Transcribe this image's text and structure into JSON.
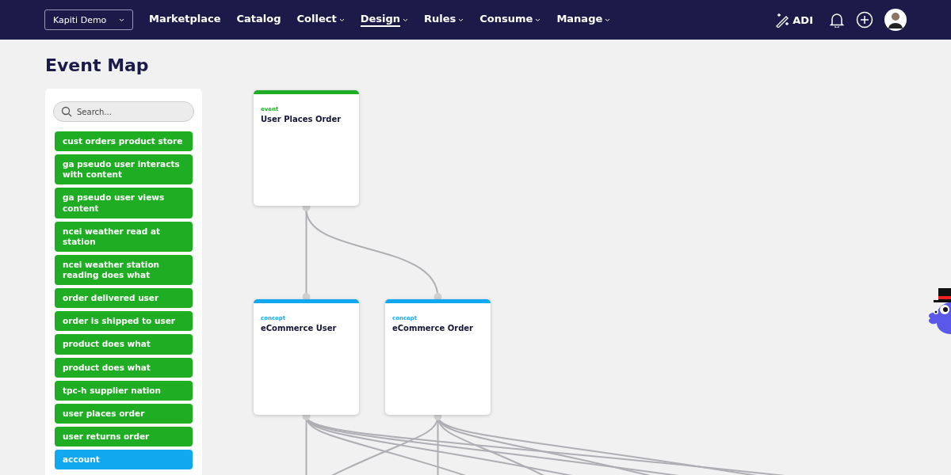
{
  "navbar": {
    "workspace": "Kapiti Demo",
    "items": [
      {
        "label": "Marketplace",
        "has_menu": false,
        "selected": false
      },
      {
        "label": "Catalog",
        "has_menu": false,
        "selected": false
      },
      {
        "label": "Collect",
        "has_menu": true,
        "selected": false
      },
      {
        "label": "Design",
        "has_menu": true,
        "selected": true
      },
      {
        "label": "Rules",
        "has_menu": true,
        "selected": false
      },
      {
        "label": "Consume",
        "has_menu": true,
        "selected": false
      },
      {
        "label": "Manage",
        "has_menu": true,
        "selected": false
      }
    ],
    "assistant": "ADI"
  },
  "page_title": "Event Map",
  "sidebar": {
    "search": {
      "placeholder": "Search..."
    },
    "items": [
      {
        "label": "cust orders product store",
        "kind": "event"
      },
      {
        "label": "ga pseudo user interacts with content",
        "kind": "event"
      },
      {
        "label": "ga pseudo user views content",
        "kind": "event"
      },
      {
        "label": "ncei weather read at station",
        "kind": "event"
      },
      {
        "label": "ncei weather station reading does what",
        "kind": "event"
      },
      {
        "label": "order delivered user",
        "kind": "event"
      },
      {
        "label": "order is shipped to user",
        "kind": "event"
      },
      {
        "label": "product does what",
        "kind": "event"
      },
      {
        "label": "product does what",
        "kind": "event"
      },
      {
        "label": "tpc-h supplier nation",
        "kind": "event"
      },
      {
        "label": "user places order",
        "kind": "event"
      },
      {
        "label": "user returns order",
        "kind": "event"
      },
      {
        "label": "account",
        "kind": "concept"
      }
    ]
  },
  "map": {
    "nodes": [
      {
        "type": "event",
        "title": "User Places Order",
        "kind": "event"
      },
      {
        "type": "concept",
        "title": "eCommerce User",
        "kind": "concept"
      },
      {
        "type": "concept",
        "title": "eCommerce Order",
        "kind": "concept"
      }
    ]
  }
}
